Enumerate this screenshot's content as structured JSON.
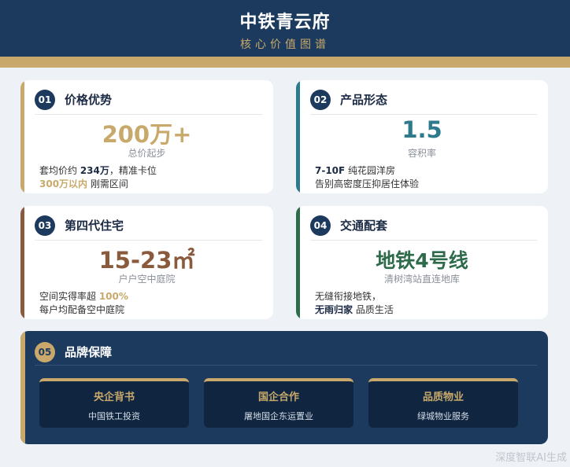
{
  "header": {
    "title": "中铁青云府",
    "subtitle": "核心价值图谱"
  },
  "colors": {
    "navy": "#1c3a5e",
    "gold": "#c8a96b",
    "teal": "#2c7a8c",
    "brown": "#8a5a3c",
    "green": "#2e6b4a"
  },
  "cards": [
    {
      "num": "01",
      "title": "价格优势",
      "big": "200万+",
      "caption": "总价起步",
      "line1_a": "套均价约 ",
      "line1_b": "234万",
      "line1_c": "，精准卡位",
      "line2_a": "300万以内",
      "line2_b": " 刚需区间"
    },
    {
      "num": "02",
      "title": "产品形态",
      "big": "1.5",
      "caption": "容积率",
      "line1_a": "7-10F",
      "line1_b": " 纯花园洋房",
      "line2_a": "告别高密度压抑居住体验"
    },
    {
      "num": "03",
      "title": "第四代住宅",
      "big": "15-23㎡",
      "caption": "户户空中庭院",
      "line1_a": "空间实得率超 ",
      "line1_b": "100%",
      "line2_a": "每户均配备空中庭院"
    },
    {
      "num": "04",
      "title": "交通配套",
      "big": "地铁4号线",
      "caption": "清树湾站直连地库",
      "line1_a": "无缝衔接地铁，",
      "line2_a": "无雨归家",
      "line2_b": " 品质生活"
    }
  ],
  "brand": {
    "num": "05",
    "title": "品牌保障",
    "items": [
      {
        "title": "央企背书",
        "desc": "中国铁工投资"
      },
      {
        "title": "国企合作",
        "desc": "屠地国企东运置业"
      },
      {
        "title": "品质物业",
        "desc": "绿城物业服务"
      }
    ]
  },
  "watermark": "深度智联AI生成"
}
